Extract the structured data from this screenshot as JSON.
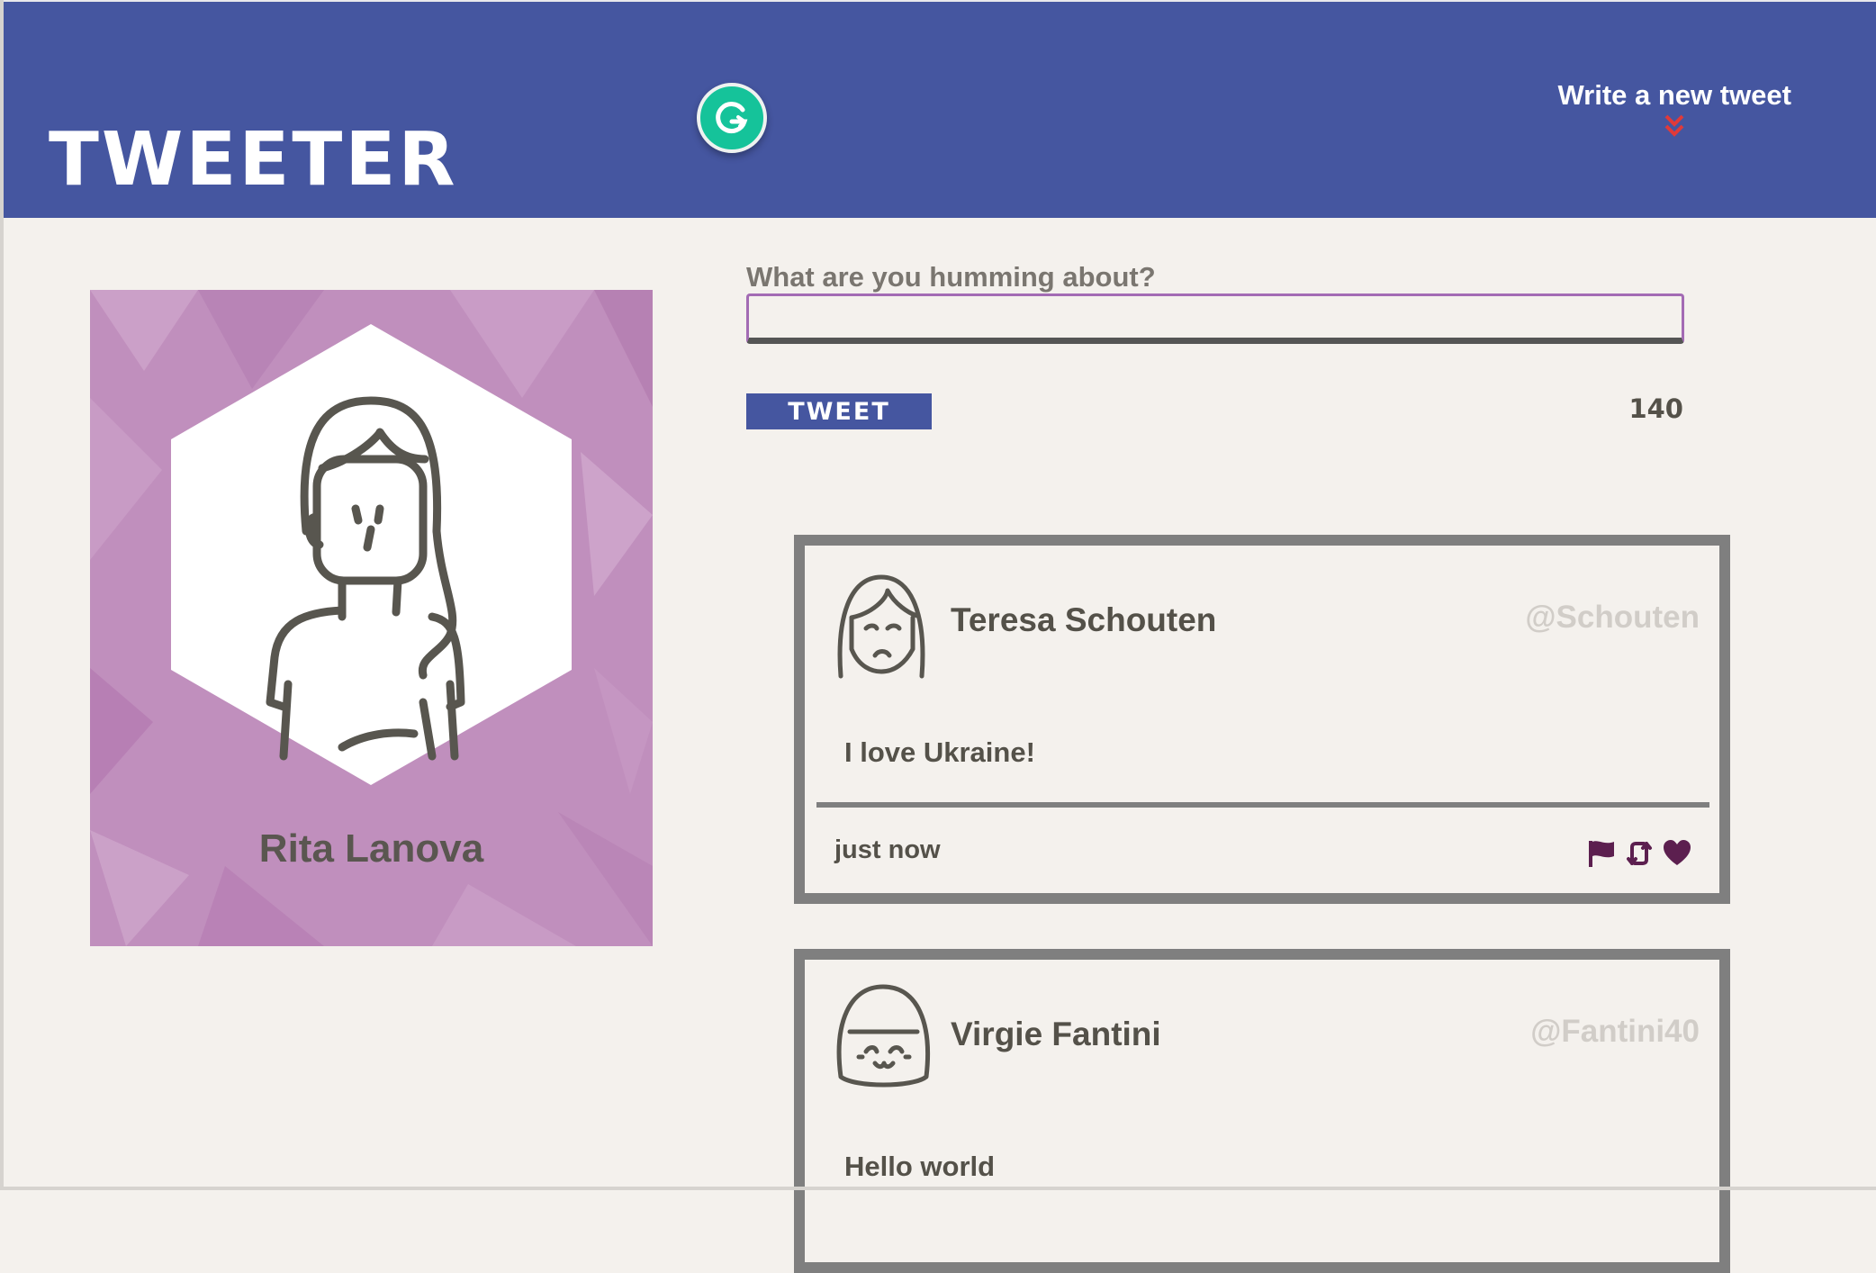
{
  "app": {
    "logo": "TWEETER",
    "compose_link": "Write a new tweet"
  },
  "profile": {
    "name": "Rita Lanova"
  },
  "composer": {
    "label": "What are you humming about?",
    "input_value": "",
    "placeholder": "",
    "button_label": "TWEET",
    "char_count": "140"
  },
  "tweets": [
    {
      "name": "Teresa Schouten",
      "handle": "@Schouten",
      "content": "I love Ukraine!",
      "time": "just now"
    },
    {
      "name": "Virgie Fantini",
      "handle": "@Fantini40",
      "content": "Hello world"
    }
  ],
  "colors": {
    "header": "#4556a0",
    "background": "#f4f1ed",
    "profile_card": "#c08fbd",
    "accent_red": "#e03a3a",
    "action_icons": "#5c1f4f"
  }
}
